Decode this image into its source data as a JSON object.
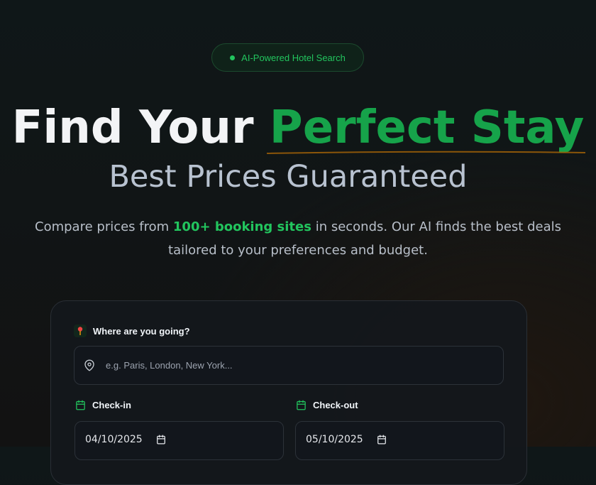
{
  "badge": {
    "text": "AI-Powered Hotel Search"
  },
  "hero": {
    "headline_main": "Find Your ",
    "headline_accent": "Perfect Stay",
    "subheadline": "Best Prices Guaranteed",
    "desc_before": "Compare prices from ",
    "desc_highlight": "100+ booking sites",
    "desc_after": " in seconds. Our AI finds the best deals tailored to your preferences and budget."
  },
  "search": {
    "destination_label": "Where are you going?",
    "destination_placeholder": "e.g. Paris, London, New York...",
    "checkin_label": "Check-in",
    "checkin_value": "04/10/2025",
    "checkout_label": "Check-out",
    "checkout_value": "05/10/2025"
  },
  "colors": {
    "accent": "#16a34a",
    "accent_light": "#22c55e",
    "underline": "#a16207"
  },
  "icons": [
    "status-dot-icon",
    "pin-icon",
    "map-pin-icon",
    "calendar-icon"
  ]
}
